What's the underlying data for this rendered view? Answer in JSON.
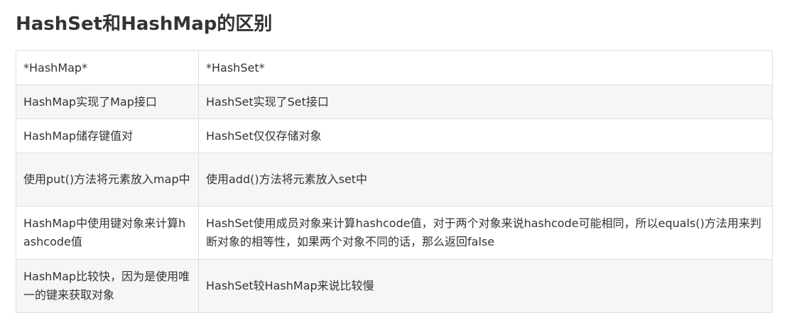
{
  "heading": "HashSet和HashMap的区别",
  "table": {
    "header": [
      "*HashMap*",
      "*HashSet*"
    ],
    "rows": [
      [
        "HashMap实现了Map接口",
        "HashSet实现了Set接口"
      ],
      [
        "HashMap储存键值对",
        "HashSet仅仅存储对象"
      ],
      [
        "使用put()方法将元素放入map中",
        "使用add()方法将元素放入set中"
      ],
      [
        "HashMap中使用键对象来计算hashcode值",
        "HashSet使用成员对象来计算hashcode值，对于两个对象来说hashcode可能相同，所以equals()方法用来判断对象的相等性，如果两个对象不同的话，那么返回false"
      ],
      [
        "HashMap比较快，因为是使用唯一的键来获取对象",
        "HashSet较HashMap来说比较慢"
      ]
    ]
  }
}
